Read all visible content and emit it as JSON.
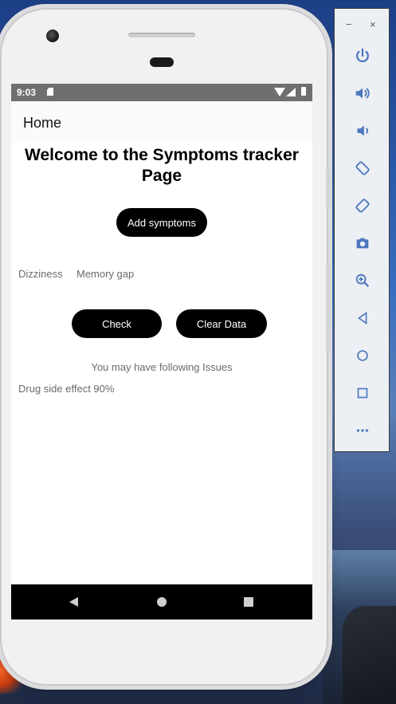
{
  "status_bar": {
    "time": "9:03"
  },
  "app_bar": {
    "title": "Home"
  },
  "page": {
    "title": "Welcome to the Symptoms tracker Page",
    "add_button": "Add symptoms",
    "symptoms": [
      "Dizziness",
      "Memory gap"
    ],
    "check_button": "Check",
    "clear_button": "Clear Data",
    "issues_heading": "You may have following Issues",
    "issues": [
      "Drug side effect 90%"
    ]
  },
  "emulator_toolbar": {
    "minimize": "−",
    "close": "×",
    "icons": [
      "power-icon",
      "volume-up-icon",
      "volume-down-icon",
      "rotate-left-icon",
      "rotate-right-icon",
      "camera-icon",
      "zoom-icon",
      "back-icon",
      "home-icon",
      "overview-icon",
      "more-icon"
    ]
  },
  "colors": {
    "accent": "#4b77be",
    "button": "#000000",
    "status_bar": "#6f6f6f"
  }
}
